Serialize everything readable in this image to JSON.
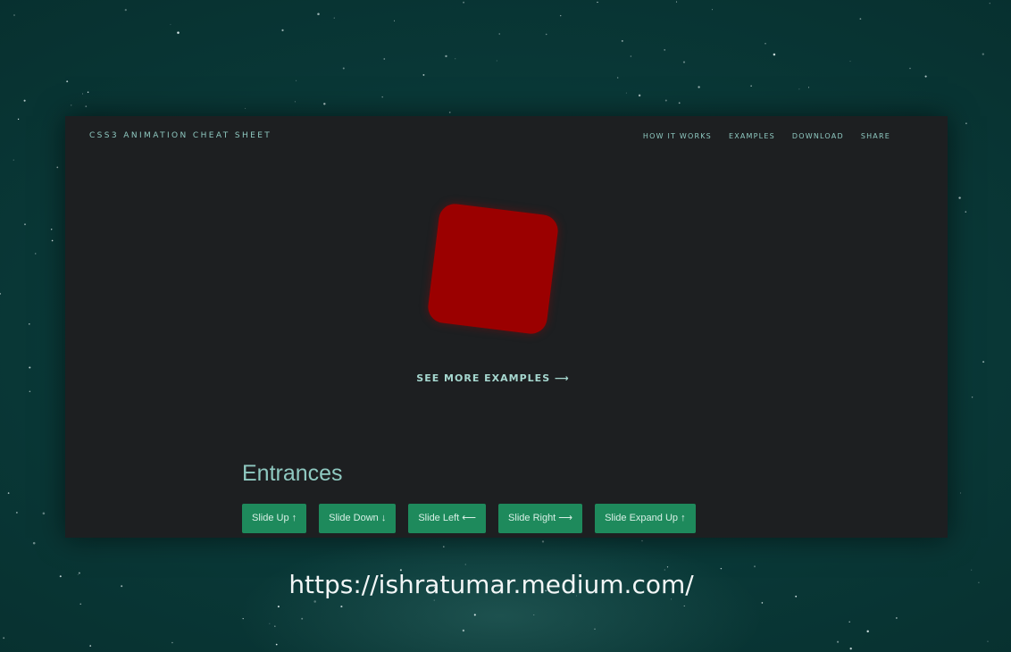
{
  "window": {
    "brand": "CSS3 ANIMATION CHEAT SHEET",
    "nav": [
      "HOW IT WORKS",
      "EXAMPLES",
      "DOWNLOAD",
      "SHARE"
    ],
    "see_more": "SEE MORE EXAMPLES ⟶",
    "section_title": "Entrances",
    "buttons": [
      "Slide Up ↑",
      "Slide Down ↓",
      "Slide Left ⟵",
      "Slide Right ⟶",
      "Slide Expand Up ↑"
    ]
  },
  "caption": {
    "url": "https://ishratumar.medium.com/"
  },
  "colors": {
    "background": "#0a3a39",
    "window_bg": "#1d1f21",
    "accent_text": "#8fc9c1",
    "button_bg": "#1e8a5c",
    "demo_box": "#9b0000"
  }
}
